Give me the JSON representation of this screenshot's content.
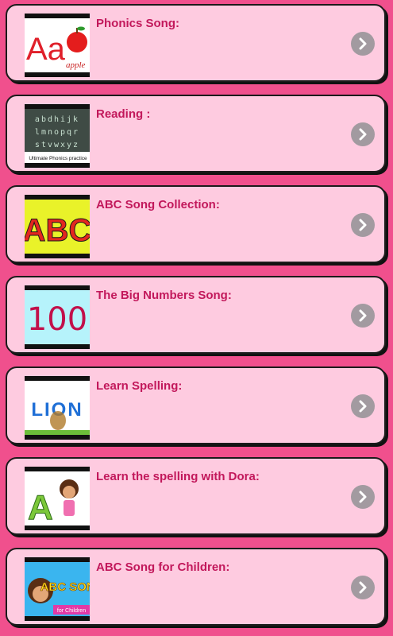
{
  "items": [
    {
      "title": "Phonics Song:",
      "thumb_text": "Aa",
      "thumb_sub": "apple"
    },
    {
      "title": "Reading :",
      "thumb_rows": [
        "abdhijk",
        "lmnopqr",
        "stvwxyz"
      ],
      "thumb_caption": "Ultimate Phonics practice"
    },
    {
      "title": "ABC Song Collection:",
      "thumb_text": "ABC"
    },
    {
      "title": "The Big Numbers Song:",
      "thumb_text": "100"
    },
    {
      "title": "Learn Spelling:",
      "thumb_text": "LION"
    },
    {
      "title": "Learn the spelling with Dora:",
      "thumb_text": "A"
    },
    {
      "title": "ABC Song for Children:",
      "thumb_text": "ABC SONG",
      "thumb_caption": "for Children"
    }
  ],
  "colors": {
    "background": "#f0508d",
    "card": "#fecbe0",
    "title": "#c2185b",
    "chevron": "#a29aa0"
  }
}
